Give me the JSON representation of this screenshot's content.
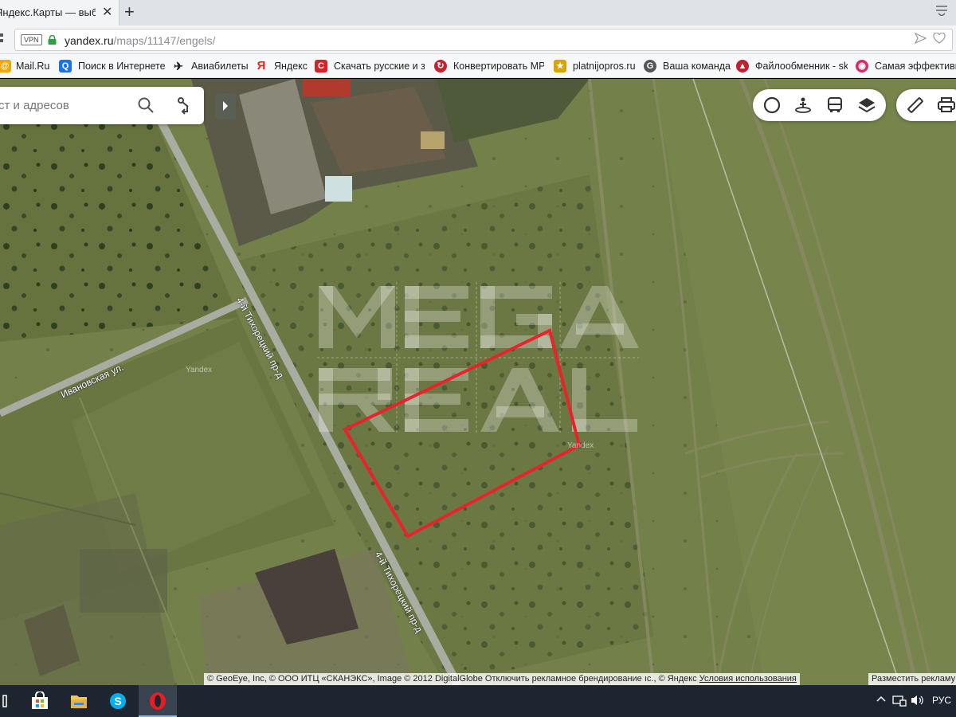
{
  "browser": {
    "tab_title": "Яндекс.Карты — выбирай",
    "tab_close": "✕",
    "new_tab": "+",
    "vpn_label": "VPN",
    "url_host": "yandex.ru",
    "url_path": "/maps/11147/engels/",
    "bookmarks": [
      {
        "label": "Mail.Ru",
        "icon": "mailru-icon",
        "color": "#f7a600"
      },
      {
        "label": "Поиск в Интернете",
        "icon": "search-q-icon",
        "color": "#1a73e8"
      },
      {
        "label": "Авиабилеты",
        "icon": "plane-icon",
        "color": "#222222"
      },
      {
        "label": "Яндекс",
        "icon": "yandex-icon",
        "color": "#e52620"
      },
      {
        "label": "Скачать русские и за",
        "icon": "download-c-icon",
        "color": "#d6232a"
      },
      {
        "label": "Конвертировать MP",
        "icon": "convert-icon",
        "color": "#c8202c"
      },
      {
        "label": "platnijopros.ru",
        "icon": "platnijopros-icon",
        "color": "#d9a400"
      },
      {
        "label": "Ваша команда",
        "icon": "team-g-icon",
        "color": "#555555"
      },
      {
        "label": "Файлообменник - sk",
        "icon": "fileshare-icon",
        "color": "#c02030"
      },
      {
        "label": "Самая эффективна",
        "icon": "effective-icon",
        "color": "#d92a6a"
      }
    ]
  },
  "map": {
    "search_placeholder": "ст и адресов",
    "road_labels": {
      "ivanovskaya": "Ивановская ул.",
      "tikhoretsky_top": "4-й Тихорецкий пр-д",
      "tikhoretsky_bottom": "4-й Тихорецкий пр-д"
    },
    "watermark_yandex": "Yandex",
    "attribution": "© GeoEye, Inc, © ООО ИТЦ «СКАНЭКС», Image © 2012 DigitalGlobe Отключить рекламное брендирование ıc., © Яндекс",
    "terms_link": "Условия использования",
    "advertise": "Разместить рекламу",
    "plot_outline_color": "#e8232b",
    "logo_text": "MEGA REAL"
  },
  "taskbar": {
    "apps": [
      "store-icon",
      "explorer-icon",
      "skype-icon",
      "opera-icon"
    ],
    "active_app": "opera-icon",
    "language": "РУС"
  }
}
